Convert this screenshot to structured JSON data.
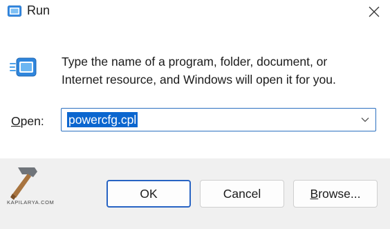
{
  "window": {
    "title": "Run",
    "title_icon": "run-icon",
    "close_icon": "close-icon"
  },
  "body": {
    "icon": "run-program-icon",
    "description": "Type the name of a program, folder, document, or Internet resource, and Windows will open it for you."
  },
  "open_field": {
    "label_mnemonic": "O",
    "label_rest": "pen:",
    "value": "powercfg.cpl",
    "dropdown_icon": "chevron-down-icon",
    "selection_color": "#0b66cf",
    "border_color": "#2a6fbf"
  },
  "buttons": {
    "ok": "OK",
    "cancel": "Cancel",
    "browse_mnemonic": "B",
    "browse_rest": "rowse..."
  },
  "watermark": {
    "text": "KAPILARYA.COM",
    "icon": "hammer-logo-icon"
  }
}
